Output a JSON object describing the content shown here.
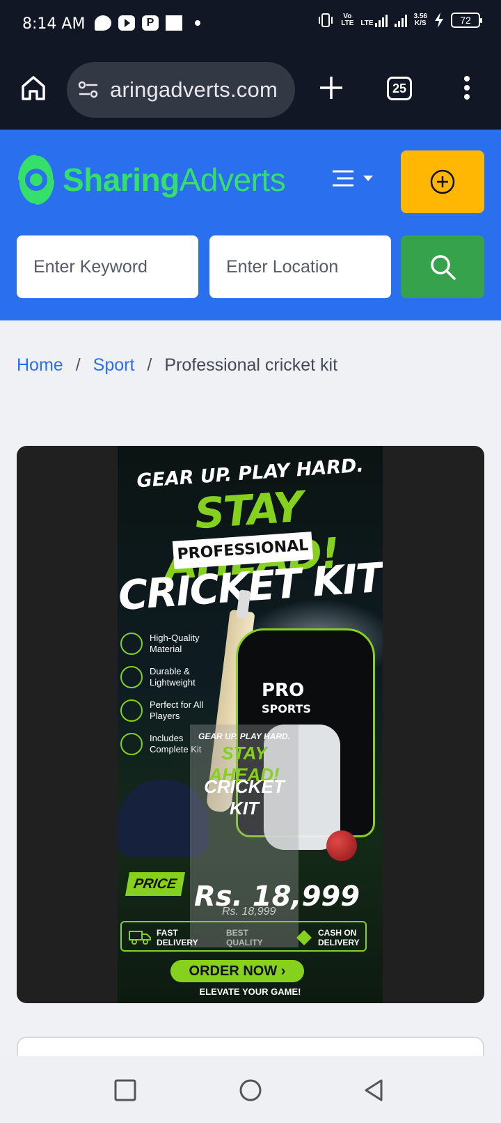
{
  "status_bar": {
    "time": "8:14 AM",
    "net_label_1": "Vo",
    "net_label_2": "LTE",
    "lte_label": "LTE",
    "speed_value": "3.56",
    "speed_unit": "K/S",
    "battery": "72"
  },
  "browser": {
    "url": "aringadverts.com",
    "tab_count": "25"
  },
  "site": {
    "logo_bold": "Sharing",
    "logo_light": "Adverts",
    "brand_color": "#35e06a",
    "header_color": "#2a6fee",
    "post_ad_color": "#ffb703",
    "search_button_color": "#37a24c"
  },
  "search": {
    "keyword_placeholder": "Enter Keyword",
    "location_placeholder": "Enter Location"
  },
  "breadcrumb": {
    "home": "Home",
    "sep": "/",
    "category": "Sport",
    "current": "Professional cricket kit"
  },
  "poster": {
    "line1": "GEAR UP. PLAY HARD.",
    "line2": "STAY AHEAD!",
    "line3": "PROFESSIONAL",
    "line4": "CRICKET KIT",
    "features": [
      "High-Quality Material",
      "Durable & Lightweight",
      "Perfect for All Players",
      "Includes Complete Kit"
    ],
    "bag_brand_1": "PRO",
    "bag_brand_2": "SPORTS",
    "price_label": "PRICE",
    "price": "Rs. 18,999",
    "price_small": "Rs. 18,999",
    "delivery_1": "FAST DELIVERY",
    "delivery_2": "BEST QUALITY",
    "delivery_3": "CASH ON DELIVERY",
    "order_button": "ORDER NOW ›",
    "tagline": "ELEVATE YOUR GAME!",
    "accent_color": "#86d11e"
  }
}
